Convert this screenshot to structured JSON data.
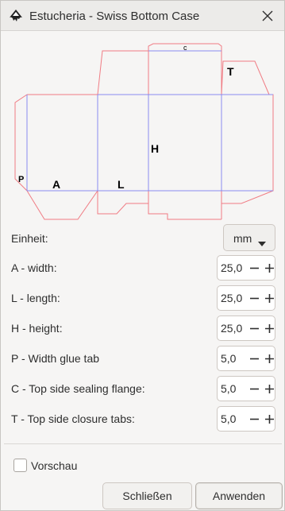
{
  "window": {
    "title": "Estucheria - Swiss Bottom Case"
  },
  "diagram": {
    "labels": {
      "c": "c",
      "T": "T",
      "H": "H",
      "P": "P",
      "A": "A",
      "L": "L"
    },
    "colors": {
      "cut": "#f07c84",
      "fold": "#8a8af0"
    }
  },
  "form": {
    "unit": {
      "label": "Einheit:",
      "value": "mm"
    },
    "fields": [
      {
        "label": "A - width:",
        "value": "25,0"
      },
      {
        "label": "L - length:",
        "value": "25,0"
      },
      {
        "label": "H - height:",
        "value": "25,0"
      },
      {
        "label": "P - Width glue tab",
        "value": "5,0"
      },
      {
        "label": "C - Top side sealing flange:",
        "value": "5,0"
      },
      {
        "label": "T - Top side closure tabs:",
        "value": "5,0"
      }
    ]
  },
  "preview": {
    "label": "Vorschau",
    "checked": false
  },
  "buttons": {
    "close": "Schließen",
    "apply": "Anwenden"
  },
  "icons": [
    "inkscape-icon",
    "close-icon",
    "caret-down-icon",
    "minus-icon",
    "plus-icon"
  ]
}
